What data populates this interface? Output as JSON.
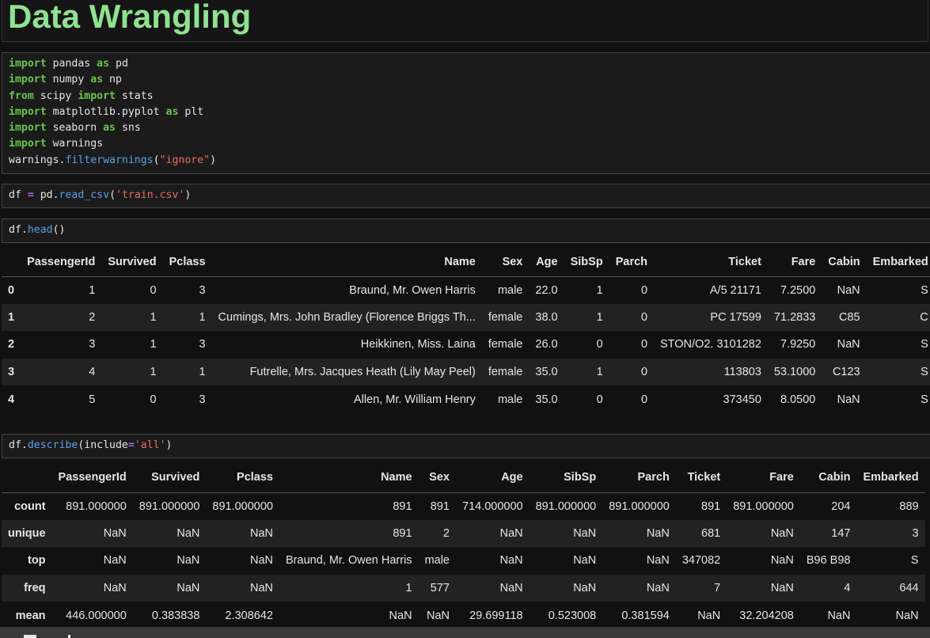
{
  "title": "Data Wrangling",
  "cells": {
    "imports": [
      [
        {
          "t": "import",
          "c": "kw"
        },
        {
          "t": " pandas "
        },
        {
          "t": "as",
          "c": "kw"
        },
        {
          "t": " pd"
        }
      ],
      [
        {
          "t": "import",
          "c": "kw"
        },
        {
          "t": " numpy "
        },
        {
          "t": "as",
          "c": "kw"
        },
        {
          "t": " np"
        }
      ],
      [
        {
          "t": "from",
          "c": "kw"
        },
        {
          "t": " scipy "
        },
        {
          "t": "import",
          "c": "kw"
        },
        {
          "t": " stats"
        }
      ],
      [
        {
          "t": "import",
          "c": "kw"
        },
        {
          "t": " matplotlib.pyplot "
        },
        {
          "t": "as",
          "c": "kw"
        },
        {
          "t": " plt"
        }
      ],
      [
        {
          "t": "import",
          "c": "kw"
        },
        {
          "t": " seaborn "
        },
        {
          "t": "as",
          "c": "kw"
        },
        {
          "t": " sns"
        }
      ],
      [
        {
          "t": "import",
          "c": "kw"
        },
        {
          "t": " warnings"
        }
      ],
      [
        {
          "t": "warnings."
        },
        {
          "t": "filterwarnings",
          "c": "fn"
        },
        {
          "t": "("
        },
        {
          "t": "\"ignore\"",
          "c": "str"
        },
        {
          "t": ")"
        }
      ]
    ],
    "read_csv": [
      [
        {
          "t": "df "
        },
        {
          "t": "=",
          "c": "op"
        },
        {
          "t": " pd."
        },
        {
          "t": "read_csv",
          "c": "fn"
        },
        {
          "t": "("
        },
        {
          "t": "'train.csv'",
          "c": "str"
        },
        {
          "t": ")"
        }
      ]
    ],
    "head": [
      [
        {
          "t": "df."
        },
        {
          "t": "head",
          "c": "fn"
        },
        {
          "t": "()"
        }
      ]
    ],
    "describe": [
      [
        {
          "t": "df."
        },
        {
          "t": "describe",
          "c": "fn"
        },
        {
          "t": "(include"
        },
        {
          "t": "=",
          "c": "op"
        },
        {
          "t": "'all'",
          "c": "str"
        },
        {
          "t": ")"
        }
      ]
    ]
  },
  "head_table": {
    "columns": [
      "",
      "PassengerId",
      "Survived",
      "Pclass",
      "Name",
      "Sex",
      "Age",
      "SibSp",
      "Parch",
      "Ticket",
      "Fare",
      "Cabin",
      "Embarked"
    ],
    "rows": [
      [
        "0",
        "1",
        "0",
        "3",
        "Braund, Mr. Owen Harris",
        "male",
        "22.0",
        "1",
        "0",
        "A/5 21171",
        "7.2500",
        "NaN",
        "S"
      ],
      [
        "1",
        "2",
        "1",
        "1",
        "Cumings, Mrs. John Bradley (Florence Briggs Th...",
        "female",
        "38.0",
        "1",
        "0",
        "PC 17599",
        "71.2833",
        "C85",
        "C"
      ],
      [
        "2",
        "3",
        "1",
        "3",
        "Heikkinen, Miss. Laina",
        "female",
        "26.0",
        "0",
        "0",
        "STON/O2. 3101282",
        "7.9250",
        "NaN",
        "S"
      ],
      [
        "3",
        "4",
        "1",
        "1",
        "Futrelle, Mrs. Jacques Heath (Lily May Peel)",
        "female",
        "35.0",
        "1",
        "0",
        "113803",
        "53.1000",
        "C123",
        "S"
      ],
      [
        "4",
        "5",
        "0",
        "3",
        "Allen, Mr. William Henry",
        "male",
        "35.0",
        "0",
        "0",
        "373450",
        "8.0500",
        "NaN",
        "S"
      ]
    ]
  },
  "describe_table": {
    "columns": [
      "",
      "PassengerId",
      "Survived",
      "Pclass",
      "Name",
      "Sex",
      "Age",
      "SibSp",
      "Parch",
      "Ticket",
      "Fare",
      "Cabin",
      "Embarked"
    ],
    "rows": [
      [
        "count",
        "891.000000",
        "891.000000",
        "891.000000",
        "891",
        "891",
        "714.000000",
        "891.000000",
        "891.000000",
        "891",
        "891.000000",
        "204",
        "889"
      ],
      [
        "unique",
        "NaN",
        "NaN",
        "NaN",
        "891",
        "2",
        "NaN",
        "NaN",
        "NaN",
        "681",
        "NaN",
        "147",
        "3"
      ],
      [
        "top",
        "NaN",
        "NaN",
        "NaN",
        "Braund, Mr. Owen Harris",
        "male",
        "NaN",
        "NaN",
        "NaN",
        "347082",
        "NaN",
        "B96 B98",
        "S"
      ],
      [
        "freq",
        "NaN",
        "NaN",
        "NaN",
        "1",
        "577",
        "NaN",
        "NaN",
        "NaN",
        "7",
        "NaN",
        "4",
        "644"
      ],
      [
        "mean",
        "446.000000",
        "0.383838",
        "2.308642",
        "NaN",
        "NaN",
        "29.699118",
        "0.523008",
        "0.381594",
        "NaN",
        "32.204208",
        "NaN",
        "NaN"
      ]
    ]
  }
}
